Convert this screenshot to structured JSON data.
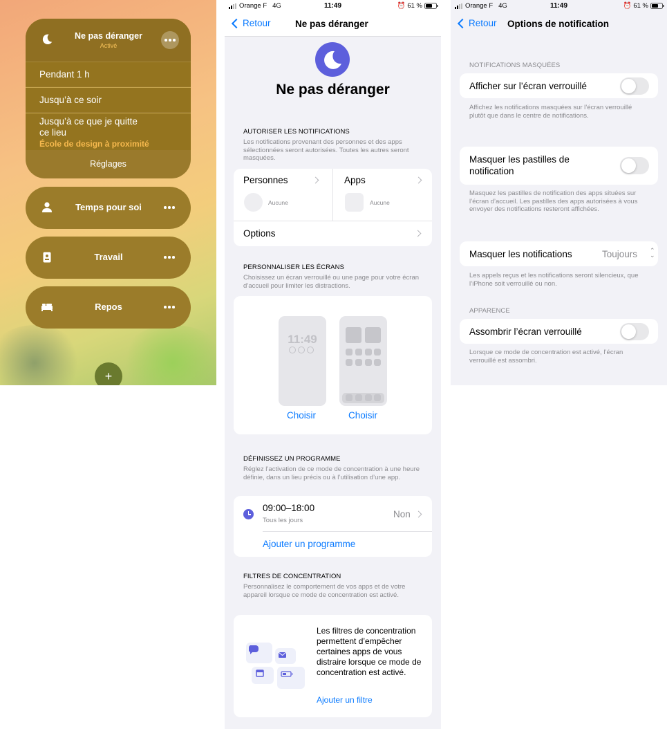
{
  "focus_panel": {
    "dnd": {
      "title": "Ne pas déranger",
      "status": "Activé",
      "options": [
        "Pendant 1 h",
        "Jusqu’à ce soir",
        "Jusqu’à ce que je quitte\nce lieu"
      ],
      "location": "École de design à proximité",
      "settings_label": "Réglages"
    },
    "modes": [
      {
        "label": "Temps pour soi",
        "icon": "person-icon"
      },
      {
        "label": "Travail",
        "icon": "badge-icon"
      },
      {
        "label": "Repos",
        "icon": "bed-icon"
      }
    ],
    "add_label": "+"
  },
  "status_bar": {
    "carrier": "Orange F",
    "network": "4G",
    "time": "11:49",
    "battery": "61 %",
    "battery_level": 0.61
  },
  "dnd_settings": {
    "back_label": "Retour",
    "nav_title": "Ne pas déranger",
    "page_title": "Ne pas déranger",
    "allow": {
      "header": "AUTORISER LES NOTIFICATIONS",
      "description": "Les notifications provenant des personnes et des apps sélectionnées seront autorisées. Toutes les autres seront masquées.",
      "people_label": "Personnes",
      "people_value": "Aucune",
      "apps_label": "Apps",
      "apps_value": "Aucune",
      "options_label": "Options"
    },
    "screens": {
      "header": "PERSONNALISER LES ÉCRANS",
      "description": "Choisissez un écran verrouillé ou une page pour votre écran d’accueil pour limiter les distractions.",
      "lock_time": "11:49",
      "choose_lock": "Choisir",
      "choose_home": "Choisir"
    },
    "schedule": {
      "header": "DÉFINISSEZ UN PROGRAMME",
      "description": "Réglez l’activation de ce mode de concentration à une heure définie, dans un lieu précis ou à l’utilisation d’une app.",
      "time_range": "09:00–18:00",
      "days": "Tous les jours",
      "state": "Non",
      "add_label": "Ajouter un programme"
    },
    "filters": {
      "header": "FILTRES DE CONCENTRATION",
      "description": "Personnalisez le comportement de vos apps et de votre appareil lorsque ce mode de concentration est activé.",
      "body": "Les filtres de concentration permettent d’empêcher certaines apps de vous distraire lorsque ce mode de concentration est activé.",
      "add_label": "Ajouter un filtre"
    }
  },
  "notification_options": {
    "back_label": "Retour",
    "nav_title": "Options de notification",
    "hidden_header": "NOTIFICATIONS MASQUÉES",
    "show_lock_label": "Afficher sur l’écran verrouillé",
    "show_lock_on": false,
    "show_lock_footer": "Affichez les notifications masquées sur l’écran verrouillé plutôt que dans le centre de notifications.",
    "hide_badges_label": "Masquer les pastilles de notification",
    "hide_badges_on": false,
    "hide_badges_footer": "Masquez les pastilles de notification des apps situées sur l’écran d’accueil. Les pastilles des apps autorisées à vous envoyer des notifications resteront affichées.",
    "silence_label": "Masquer les notifications",
    "silence_value": "Toujours",
    "silence_footer": "Les appels reçus et les notifications seront silencieux, que l’iPhone soit verrouillé ou non.",
    "appearance_header": "APPARENCE",
    "dim_label": "Assombrir l’écran verrouillé",
    "dim_on": false,
    "dim_footer": "Lorsque ce mode de concentration est activé, l’écran verrouillé est assombri."
  }
}
